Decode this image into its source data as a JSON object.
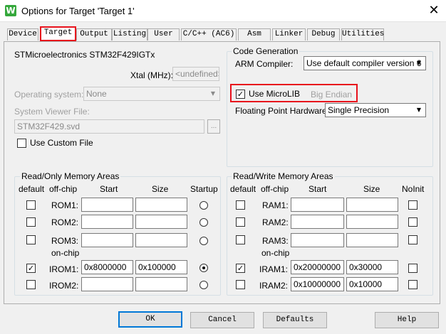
{
  "window": {
    "title": "Options for Target 'Target 1'",
    "app_icon": "W"
  },
  "tabs": [
    "Device",
    "Target",
    "Output",
    "Listing",
    "User",
    "C/C++ (AC6)",
    "Asm",
    "Linker",
    "Debug",
    "Utilities"
  ],
  "active_tab": "Target",
  "device": {
    "name": "STMicroelectronics STM32F429IGTx"
  },
  "xtal": {
    "label": "Xtal (MHz):",
    "value": "<undefined>"
  },
  "os": {
    "label": "Operating system:",
    "value": "None"
  },
  "svd": {
    "label": "System Viewer File:",
    "value": "STM32F429.svd",
    "browse": "..."
  },
  "custom_file": {
    "label": "Use Custom File",
    "checked": false
  },
  "codegen": {
    "title": "Code Generation",
    "compiler_label": "ARM Compiler:",
    "compiler_value": "Use default compiler version 6",
    "microlib_label": "Use MicroLIB",
    "microlib_checked": true,
    "big_endian": "Big Endian",
    "fpu_label": "Floating Point Hardware:",
    "fpu_value": "Single Precision"
  },
  "rom_group": {
    "title": "Read/Only Memory Areas",
    "headers": {
      "default": "default",
      "offchip": "off-chip",
      "start": "Start",
      "size": "Size",
      "startup": "Startup"
    },
    "onchip_label": "on-chip",
    "rows": [
      {
        "label": "ROM1:",
        "checked": false,
        "start": "",
        "size": "",
        "selected": false
      },
      {
        "label": "ROM2:",
        "checked": false,
        "start": "",
        "size": "",
        "selected": false
      },
      {
        "label": "ROM3:",
        "checked": false,
        "start": "",
        "size": "",
        "selected": false
      },
      {
        "label": "IROM1:",
        "checked": true,
        "start": "0x8000000",
        "size": "0x100000",
        "selected": true
      },
      {
        "label": "IROM2:",
        "checked": false,
        "start": "",
        "size": "",
        "selected": false
      }
    ]
  },
  "ram_group": {
    "title": "Read/Write Memory Areas",
    "headers": {
      "default": "default",
      "offchip": "off-chip",
      "start": "Start",
      "size": "Size",
      "noinit": "NoInit"
    },
    "onchip_label": "on-chip",
    "rows": [
      {
        "label": "RAM1:",
        "checked": false,
        "start": "",
        "size": "",
        "noinit": false
      },
      {
        "label": "RAM2:",
        "checked": false,
        "start": "",
        "size": "",
        "noinit": false
      },
      {
        "label": "RAM3:",
        "checked": false,
        "start": "",
        "size": "",
        "noinit": false
      },
      {
        "label": "IRAM1:",
        "checked": true,
        "start": "0x20000000",
        "size": "0x30000",
        "noinit": false
      },
      {
        "label": "IRAM2:",
        "checked": false,
        "start": "0x10000000",
        "size": "0x10000",
        "noinit": false
      }
    ]
  },
  "buttons": {
    "ok": "OK",
    "cancel": "Cancel",
    "defaults": "Defaults",
    "help": "Help"
  },
  "symbols": {
    "check": "✓",
    "close": "✕",
    "dropdown": "▼"
  },
  "colors": {
    "highlight": "#e8111c",
    "default_button": "#0078d7"
  }
}
